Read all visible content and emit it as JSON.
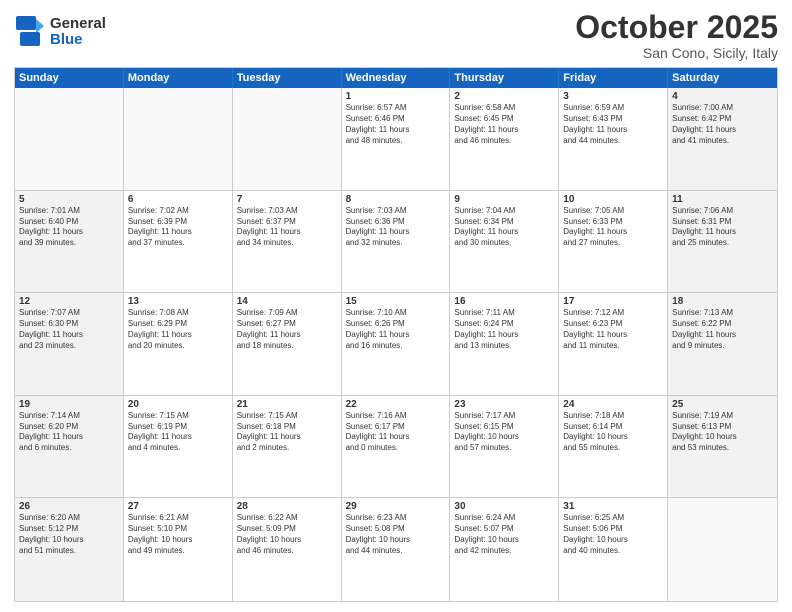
{
  "logo": {
    "general": "General",
    "blue": "Blue"
  },
  "header": {
    "month": "October 2025",
    "location": "San Cono, Sicily, Italy"
  },
  "weekdays": [
    "Sunday",
    "Monday",
    "Tuesday",
    "Wednesday",
    "Thursday",
    "Friday",
    "Saturday"
  ],
  "weeks": [
    [
      {
        "day": "",
        "text": "",
        "empty": true
      },
      {
        "day": "",
        "text": "",
        "empty": true
      },
      {
        "day": "",
        "text": "",
        "empty": true
      },
      {
        "day": "1",
        "text": "Sunrise: 6:57 AM\nSunset: 6:46 PM\nDaylight: 11 hours\nand 48 minutes."
      },
      {
        "day": "2",
        "text": "Sunrise: 6:58 AM\nSunset: 6:45 PM\nDaylight: 11 hours\nand 46 minutes."
      },
      {
        "day": "3",
        "text": "Sunrise: 6:59 AM\nSunset: 6:43 PM\nDaylight: 11 hours\nand 44 minutes."
      },
      {
        "day": "4",
        "text": "Sunrise: 7:00 AM\nSunset: 6:42 PM\nDaylight: 11 hours\nand 41 minutes.",
        "shaded": true
      }
    ],
    [
      {
        "day": "5",
        "text": "Sunrise: 7:01 AM\nSunset: 6:40 PM\nDaylight: 11 hours\nand 39 minutes.",
        "shaded": true
      },
      {
        "day": "6",
        "text": "Sunrise: 7:02 AM\nSunset: 6:39 PM\nDaylight: 11 hours\nand 37 minutes."
      },
      {
        "day": "7",
        "text": "Sunrise: 7:03 AM\nSunset: 6:37 PM\nDaylight: 11 hours\nand 34 minutes."
      },
      {
        "day": "8",
        "text": "Sunrise: 7:03 AM\nSunset: 6:36 PM\nDaylight: 11 hours\nand 32 minutes."
      },
      {
        "day": "9",
        "text": "Sunrise: 7:04 AM\nSunset: 6:34 PM\nDaylight: 11 hours\nand 30 minutes."
      },
      {
        "day": "10",
        "text": "Sunrise: 7:05 AM\nSunset: 6:33 PM\nDaylight: 11 hours\nand 27 minutes."
      },
      {
        "day": "11",
        "text": "Sunrise: 7:06 AM\nSunset: 6:31 PM\nDaylight: 11 hours\nand 25 minutes.",
        "shaded": true
      }
    ],
    [
      {
        "day": "12",
        "text": "Sunrise: 7:07 AM\nSunset: 6:30 PM\nDaylight: 11 hours\nand 23 minutes.",
        "shaded": true
      },
      {
        "day": "13",
        "text": "Sunrise: 7:08 AM\nSunset: 6:29 PM\nDaylight: 11 hours\nand 20 minutes."
      },
      {
        "day": "14",
        "text": "Sunrise: 7:09 AM\nSunset: 6:27 PM\nDaylight: 11 hours\nand 18 minutes."
      },
      {
        "day": "15",
        "text": "Sunrise: 7:10 AM\nSunset: 6:26 PM\nDaylight: 11 hours\nand 16 minutes."
      },
      {
        "day": "16",
        "text": "Sunrise: 7:11 AM\nSunset: 6:24 PM\nDaylight: 11 hours\nand 13 minutes."
      },
      {
        "day": "17",
        "text": "Sunrise: 7:12 AM\nSunset: 6:23 PM\nDaylight: 11 hours\nand 11 minutes."
      },
      {
        "day": "18",
        "text": "Sunrise: 7:13 AM\nSunset: 6:22 PM\nDaylight: 11 hours\nand 9 minutes.",
        "shaded": true
      }
    ],
    [
      {
        "day": "19",
        "text": "Sunrise: 7:14 AM\nSunset: 6:20 PM\nDaylight: 11 hours\nand 6 minutes.",
        "shaded": true
      },
      {
        "day": "20",
        "text": "Sunrise: 7:15 AM\nSunset: 6:19 PM\nDaylight: 11 hours\nand 4 minutes."
      },
      {
        "day": "21",
        "text": "Sunrise: 7:15 AM\nSunset: 6:18 PM\nDaylight: 11 hours\nand 2 minutes."
      },
      {
        "day": "22",
        "text": "Sunrise: 7:16 AM\nSunset: 6:17 PM\nDaylight: 11 hours\nand 0 minutes."
      },
      {
        "day": "23",
        "text": "Sunrise: 7:17 AM\nSunset: 6:15 PM\nDaylight: 10 hours\nand 57 minutes."
      },
      {
        "day": "24",
        "text": "Sunrise: 7:18 AM\nSunset: 6:14 PM\nDaylight: 10 hours\nand 55 minutes."
      },
      {
        "day": "25",
        "text": "Sunrise: 7:19 AM\nSunset: 6:13 PM\nDaylight: 10 hours\nand 53 minutes.",
        "shaded": true
      }
    ],
    [
      {
        "day": "26",
        "text": "Sunrise: 6:20 AM\nSunset: 5:12 PM\nDaylight: 10 hours\nand 51 minutes.",
        "shaded": true
      },
      {
        "day": "27",
        "text": "Sunrise: 6:21 AM\nSunset: 5:10 PM\nDaylight: 10 hours\nand 49 minutes."
      },
      {
        "day": "28",
        "text": "Sunrise: 6:22 AM\nSunset: 5:09 PM\nDaylight: 10 hours\nand 46 minutes."
      },
      {
        "day": "29",
        "text": "Sunrise: 6:23 AM\nSunset: 5:08 PM\nDaylight: 10 hours\nand 44 minutes."
      },
      {
        "day": "30",
        "text": "Sunrise: 6:24 AM\nSunset: 5:07 PM\nDaylight: 10 hours\nand 42 minutes."
      },
      {
        "day": "31",
        "text": "Sunrise: 6:25 AM\nSunset: 5:06 PM\nDaylight: 10 hours\nand 40 minutes."
      },
      {
        "day": "",
        "text": "",
        "empty": true,
        "shaded": true
      }
    ]
  ]
}
